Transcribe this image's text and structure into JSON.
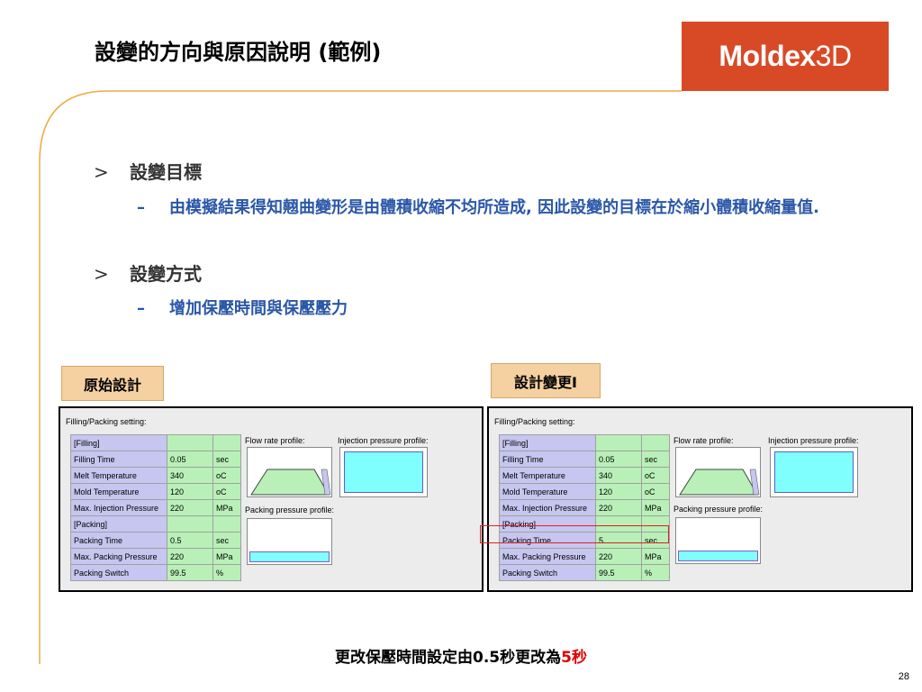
{
  "title": "設變的方向與原因說明 (範例)",
  "logo": {
    "text": "Moldex",
    "suffix": "3D"
  },
  "bullets": [
    {
      "mark": ">",
      "label": "設變目標",
      "sub": {
        "mark": "–",
        "text": "由模擬結果得知翹曲變形是由體積收縮不均所造成, 因此設變的目標在於縮小體積收縮量值."
      }
    },
    {
      "mark": ">",
      "label": "設變方式",
      "sub": {
        "mark": "–",
        "text": "增加保壓時間與保壓壓力"
      }
    }
  ],
  "tags": {
    "original": "原始設計",
    "changed": "設計變更I"
  },
  "panel": {
    "title": "Filling/Packing setting:",
    "flow_label": "Flow rate profile:",
    "injection_label": "Injection pressure profile:",
    "packing_label": "Packing pressure profile:"
  },
  "original_rows": [
    {
      "name": "[Filling]",
      "value": "",
      "unit": ""
    },
    {
      "name": "Filling Time",
      "value": "0.05",
      "unit": "sec"
    },
    {
      "name": "Melt Temperature",
      "value": "340",
      "unit": "oC"
    },
    {
      "name": "Mold Temperature",
      "value": "120",
      "unit": "oC"
    },
    {
      "name": "Max. Injection Pressure",
      "value": "220",
      "unit": "MPa"
    },
    {
      "name": "[Packing]",
      "value": "",
      "unit": ""
    },
    {
      "name": "Packing Time",
      "value": "0.5",
      "unit": "sec"
    },
    {
      "name": "Max. Packing Pressure",
      "value": "220",
      "unit": "MPa"
    },
    {
      "name": "Packing Switch",
      "value": "99.5",
      "unit": "%"
    }
  ],
  "changed_rows": [
    {
      "name": "[Filling]",
      "value": "",
      "unit": ""
    },
    {
      "name": "Filling Time",
      "value": "0.05",
      "unit": "sec"
    },
    {
      "name": "Melt Temperature",
      "value": "340",
      "unit": "oC"
    },
    {
      "name": "Mold Temperature",
      "value": "120",
      "unit": "oC"
    },
    {
      "name": "Max. Injection Pressure",
      "value": "220",
      "unit": "MPa"
    },
    {
      "name": "[Packing]",
      "value": "",
      "unit": ""
    },
    {
      "name": "Packing Time",
      "value": "5",
      "unit": "sec"
    },
    {
      "name": "Max. Packing Pressure",
      "value": "220",
      "unit": "MPa"
    },
    {
      "name": "Packing Switch",
      "value": "99.5",
      "unit": "%"
    }
  ],
  "caption": {
    "prefix": "更改保壓時間設定由0.5秒更改為",
    "highlight": "5秒"
  },
  "page_number": "28",
  "colors": {
    "accent": "#d84a26",
    "bullet_blue": "#2a57a8",
    "tag_bg": "#f5d0a0",
    "highlight_red": "#e02020"
  }
}
